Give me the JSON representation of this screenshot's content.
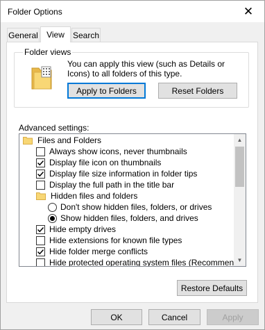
{
  "window": {
    "title": "Folder Options"
  },
  "tabs": [
    {
      "label": "General",
      "active": false
    },
    {
      "label": "View",
      "active": true
    },
    {
      "label": "Search",
      "active": false
    }
  ],
  "folder_views": {
    "title": "Folder views",
    "description": "You can apply this view (such as Details or Icons) to all folders of this type.",
    "apply_button": "Apply to Folders",
    "reset_button": "Reset Folders"
  },
  "advanced": {
    "label": "Advanced settings:",
    "items": [
      {
        "type": "folder",
        "label": "Files and Folders",
        "level": 0
      },
      {
        "type": "checkbox",
        "label": "Always show icons, never thumbnails",
        "checked": false,
        "level": 1
      },
      {
        "type": "checkbox",
        "label": "Display file icon on thumbnails",
        "checked": true,
        "level": 1
      },
      {
        "type": "checkbox",
        "label": "Display file size information in folder tips",
        "checked": true,
        "level": 1
      },
      {
        "type": "checkbox",
        "label": "Display the full path in the title bar",
        "checked": false,
        "level": 1
      },
      {
        "type": "folder",
        "label": "Hidden files and folders",
        "level": 1
      },
      {
        "type": "radio",
        "label": "Don't show hidden files, folders, or drives",
        "checked": false,
        "level": 2
      },
      {
        "type": "radio",
        "label": "Show hidden files, folders, and drives",
        "checked": true,
        "level": 2
      },
      {
        "type": "checkbox",
        "label": "Hide empty drives",
        "checked": true,
        "level": 1
      },
      {
        "type": "checkbox",
        "label": "Hide extensions for known file types",
        "checked": false,
        "level": 1
      },
      {
        "type": "checkbox",
        "label": "Hide folder merge conflicts",
        "checked": true,
        "level": 1
      },
      {
        "type": "checkbox",
        "label": "Hide protected operating system files (Recommended)",
        "checked": false,
        "level": 1
      }
    ]
  },
  "restore_defaults": "Restore Defaults",
  "footer": {
    "ok": "OK",
    "cancel": "Cancel",
    "apply": "Apply"
  },
  "icons": {
    "close": "close-icon",
    "folder": "folder-icon",
    "scroll_up": "chevron-up-icon",
    "scroll_down": "chevron-down-icon"
  },
  "colors": {
    "accent_border": "#0078d7",
    "folder_yellow": "#f8d775",
    "button_face": "#e1e1e1",
    "disabled_text": "#a0a0a0"
  }
}
